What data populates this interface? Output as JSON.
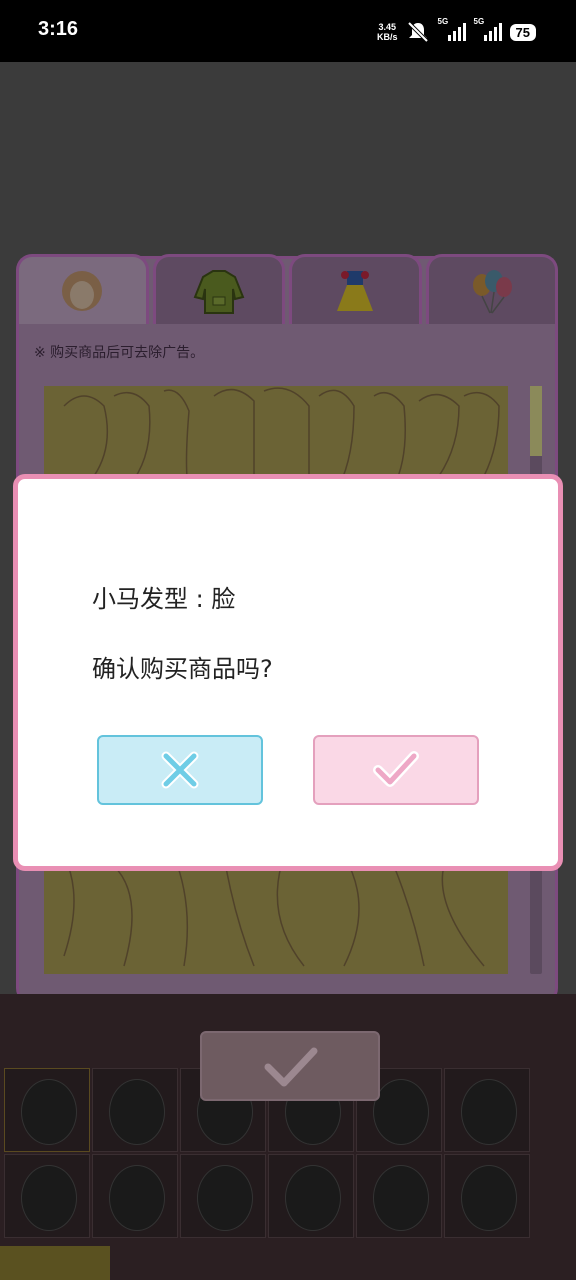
{
  "status_bar": {
    "time": "3:16",
    "speed_value": "3.45",
    "speed_unit": "KB/s",
    "network_1": "5G",
    "network_2": "5G",
    "battery": "75",
    "icons": [
      "mute-icon",
      "signal-icon",
      "signal-icon",
      "battery-icon"
    ]
  },
  "tabs": [
    {
      "icon": "hair-icon",
      "active": true
    },
    {
      "icon": "hoodie-icon",
      "active": false
    },
    {
      "icon": "dress-icon",
      "active": false
    },
    {
      "icon": "balloons-icon",
      "active": false
    }
  ],
  "notice": "※ 购买商品后可去除广告。",
  "dialog": {
    "title": "小马发型 : 脸",
    "question": "确认购买商品吗?",
    "cancel_icon": "close-icon",
    "confirm_icon": "check-icon"
  },
  "colors": {
    "dialog_border": "#e98fb4",
    "cancel_bg": "#c9ecf6",
    "cancel_border": "#63c3dc",
    "confirm_bg": "#fad8e6",
    "confirm_border": "#e4a0bd"
  }
}
